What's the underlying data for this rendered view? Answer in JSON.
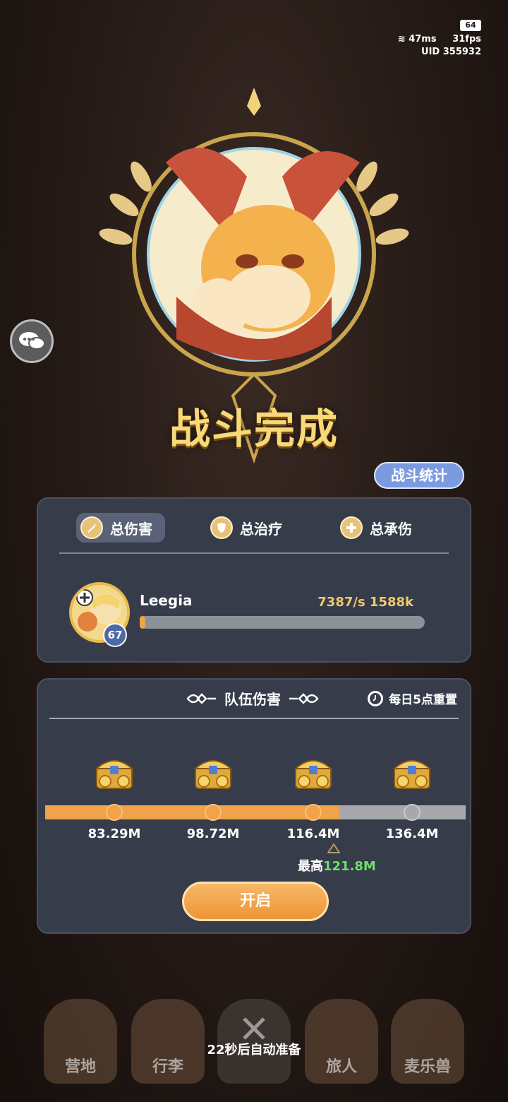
{
  "status": {
    "battery": "64",
    "ping": "47ms",
    "fps": "31fps",
    "uid": "UID 355932"
  },
  "header": {
    "title": "战斗完成",
    "stats_button": "战斗统计"
  },
  "tabs": [
    {
      "label": "总伤害",
      "icon": "sword-icon",
      "active": true
    },
    {
      "label": "总治疗",
      "icon": "shield-icon",
      "active": false
    },
    {
      "label": "总承伤",
      "icon": "heal-cross-icon",
      "active": false
    }
  ],
  "player": {
    "name": "Leegia",
    "level": "67",
    "value": "7387/s 1588k",
    "bar_fill": 0.01
  },
  "team": {
    "title": "队伍伤害",
    "reset": "每日5点重置",
    "milestones": [
      "83.29M",
      "98.72M",
      "116.4M",
      "136.4M"
    ],
    "reached": 3,
    "progress_fill": 0.7,
    "best_label": "最高",
    "best_value": "121.8M",
    "open_button": "开启"
  },
  "dock": {
    "items": [
      "营地",
      "行李",
      "",
      "旅人",
      "麦乐兽"
    ],
    "auto_text": "22秒后自动准备"
  },
  "colors": {
    "accent": "#f0a349",
    "gold": "#f8d977",
    "panel": "#363c4a",
    "best": "#6be06a"
  }
}
